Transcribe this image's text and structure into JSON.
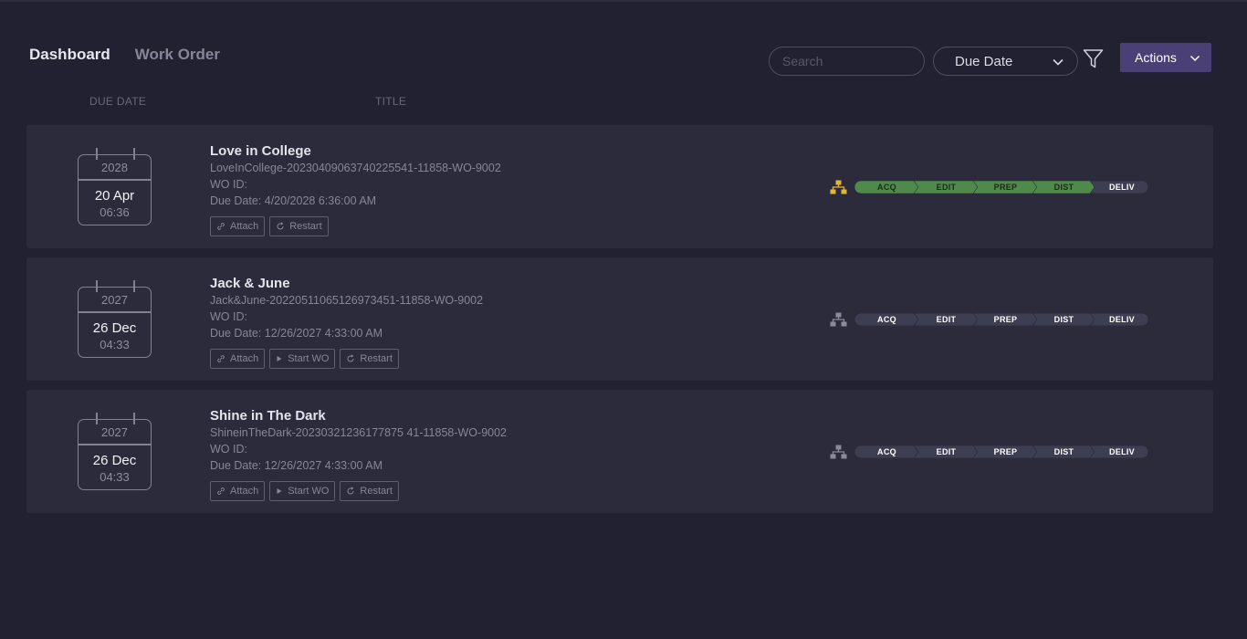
{
  "tabs": [
    {
      "label": "Dashboard",
      "active": true
    },
    {
      "label": "Work Order",
      "active": false
    }
  ],
  "search": {
    "placeholder": "Search",
    "value": ""
  },
  "sort": {
    "selected": "Due Date"
  },
  "actions_label": "Actions",
  "columns": {
    "due_date": "DUE DATE",
    "title": "TITLE"
  },
  "colors": {
    "bg": "#212131",
    "card": "#2b2b3c",
    "accent": "#4b4075",
    "stage_done": "#4f8a4a",
    "stage_pending": "#3e3e52",
    "wf_active_icon": "#e0b63a",
    "wf_idle_icon": "#8a8a9c"
  },
  "work_orders": [
    {
      "year": "2028",
      "day": "20 Apr",
      "time": "06:36",
      "title": "Love in College",
      "id_line": "LoveInCollege-20230409063740225541-11858-WO-9002",
      "wo_id": "WO ID:",
      "due_line": "Due Date: 4/20/2028 6:36:00 AM",
      "buttons": [
        {
          "label": "Attach",
          "icon": "link-icon"
        },
        {
          "label": "Restart",
          "icon": "restart-icon"
        }
      ],
      "workflow_active": true,
      "stages": [
        {
          "label": "ACQ",
          "done": true
        },
        {
          "label": "EDIT",
          "done": true
        },
        {
          "label": "PREP",
          "done": true
        },
        {
          "label": "DIST",
          "done": true
        },
        {
          "label": "DELIV",
          "done": false
        }
      ]
    },
    {
      "year": "2027",
      "day": "26 Dec",
      "time": "04:33",
      "title": "Jack & June",
      "id_line": "Jack&June-20220511065126973451-11858-WO-9002",
      "wo_id": "WO ID:",
      "due_line": "Due Date: 12/26/2027 4:33:00 AM",
      "buttons": [
        {
          "label": "Attach",
          "icon": "link-icon"
        },
        {
          "label": "Start WO",
          "icon": "play-icon"
        },
        {
          "label": "Restart",
          "icon": "restart-icon"
        }
      ],
      "workflow_active": false,
      "stages": [
        {
          "label": "ACQ",
          "done": false
        },
        {
          "label": "EDIT",
          "done": false
        },
        {
          "label": "PREP",
          "done": false
        },
        {
          "label": "DIST",
          "done": false
        },
        {
          "label": "DELIV",
          "done": false
        }
      ]
    },
    {
      "year": "2027",
      "day": "26 Dec",
      "time": "04:33",
      "title": "Shine in The Dark",
      "id_line": "ShineinTheDark-20230321236177875 41-11858-WO-9002",
      "wo_id": "WO ID:",
      "due_line": "Due Date: 12/26/2027 4:33:00 AM",
      "buttons": [
        {
          "label": "Attach",
          "icon": "link-icon"
        },
        {
          "label": "Start WO",
          "icon": "play-icon"
        },
        {
          "label": "Restart",
          "icon": "restart-icon"
        }
      ],
      "workflow_active": false,
      "stages": [
        {
          "label": "ACQ",
          "done": false
        },
        {
          "label": "EDIT",
          "done": false
        },
        {
          "label": "PREP",
          "done": false
        },
        {
          "label": "DIST",
          "done": false
        },
        {
          "label": "DELIV",
          "done": false
        }
      ]
    }
  ]
}
